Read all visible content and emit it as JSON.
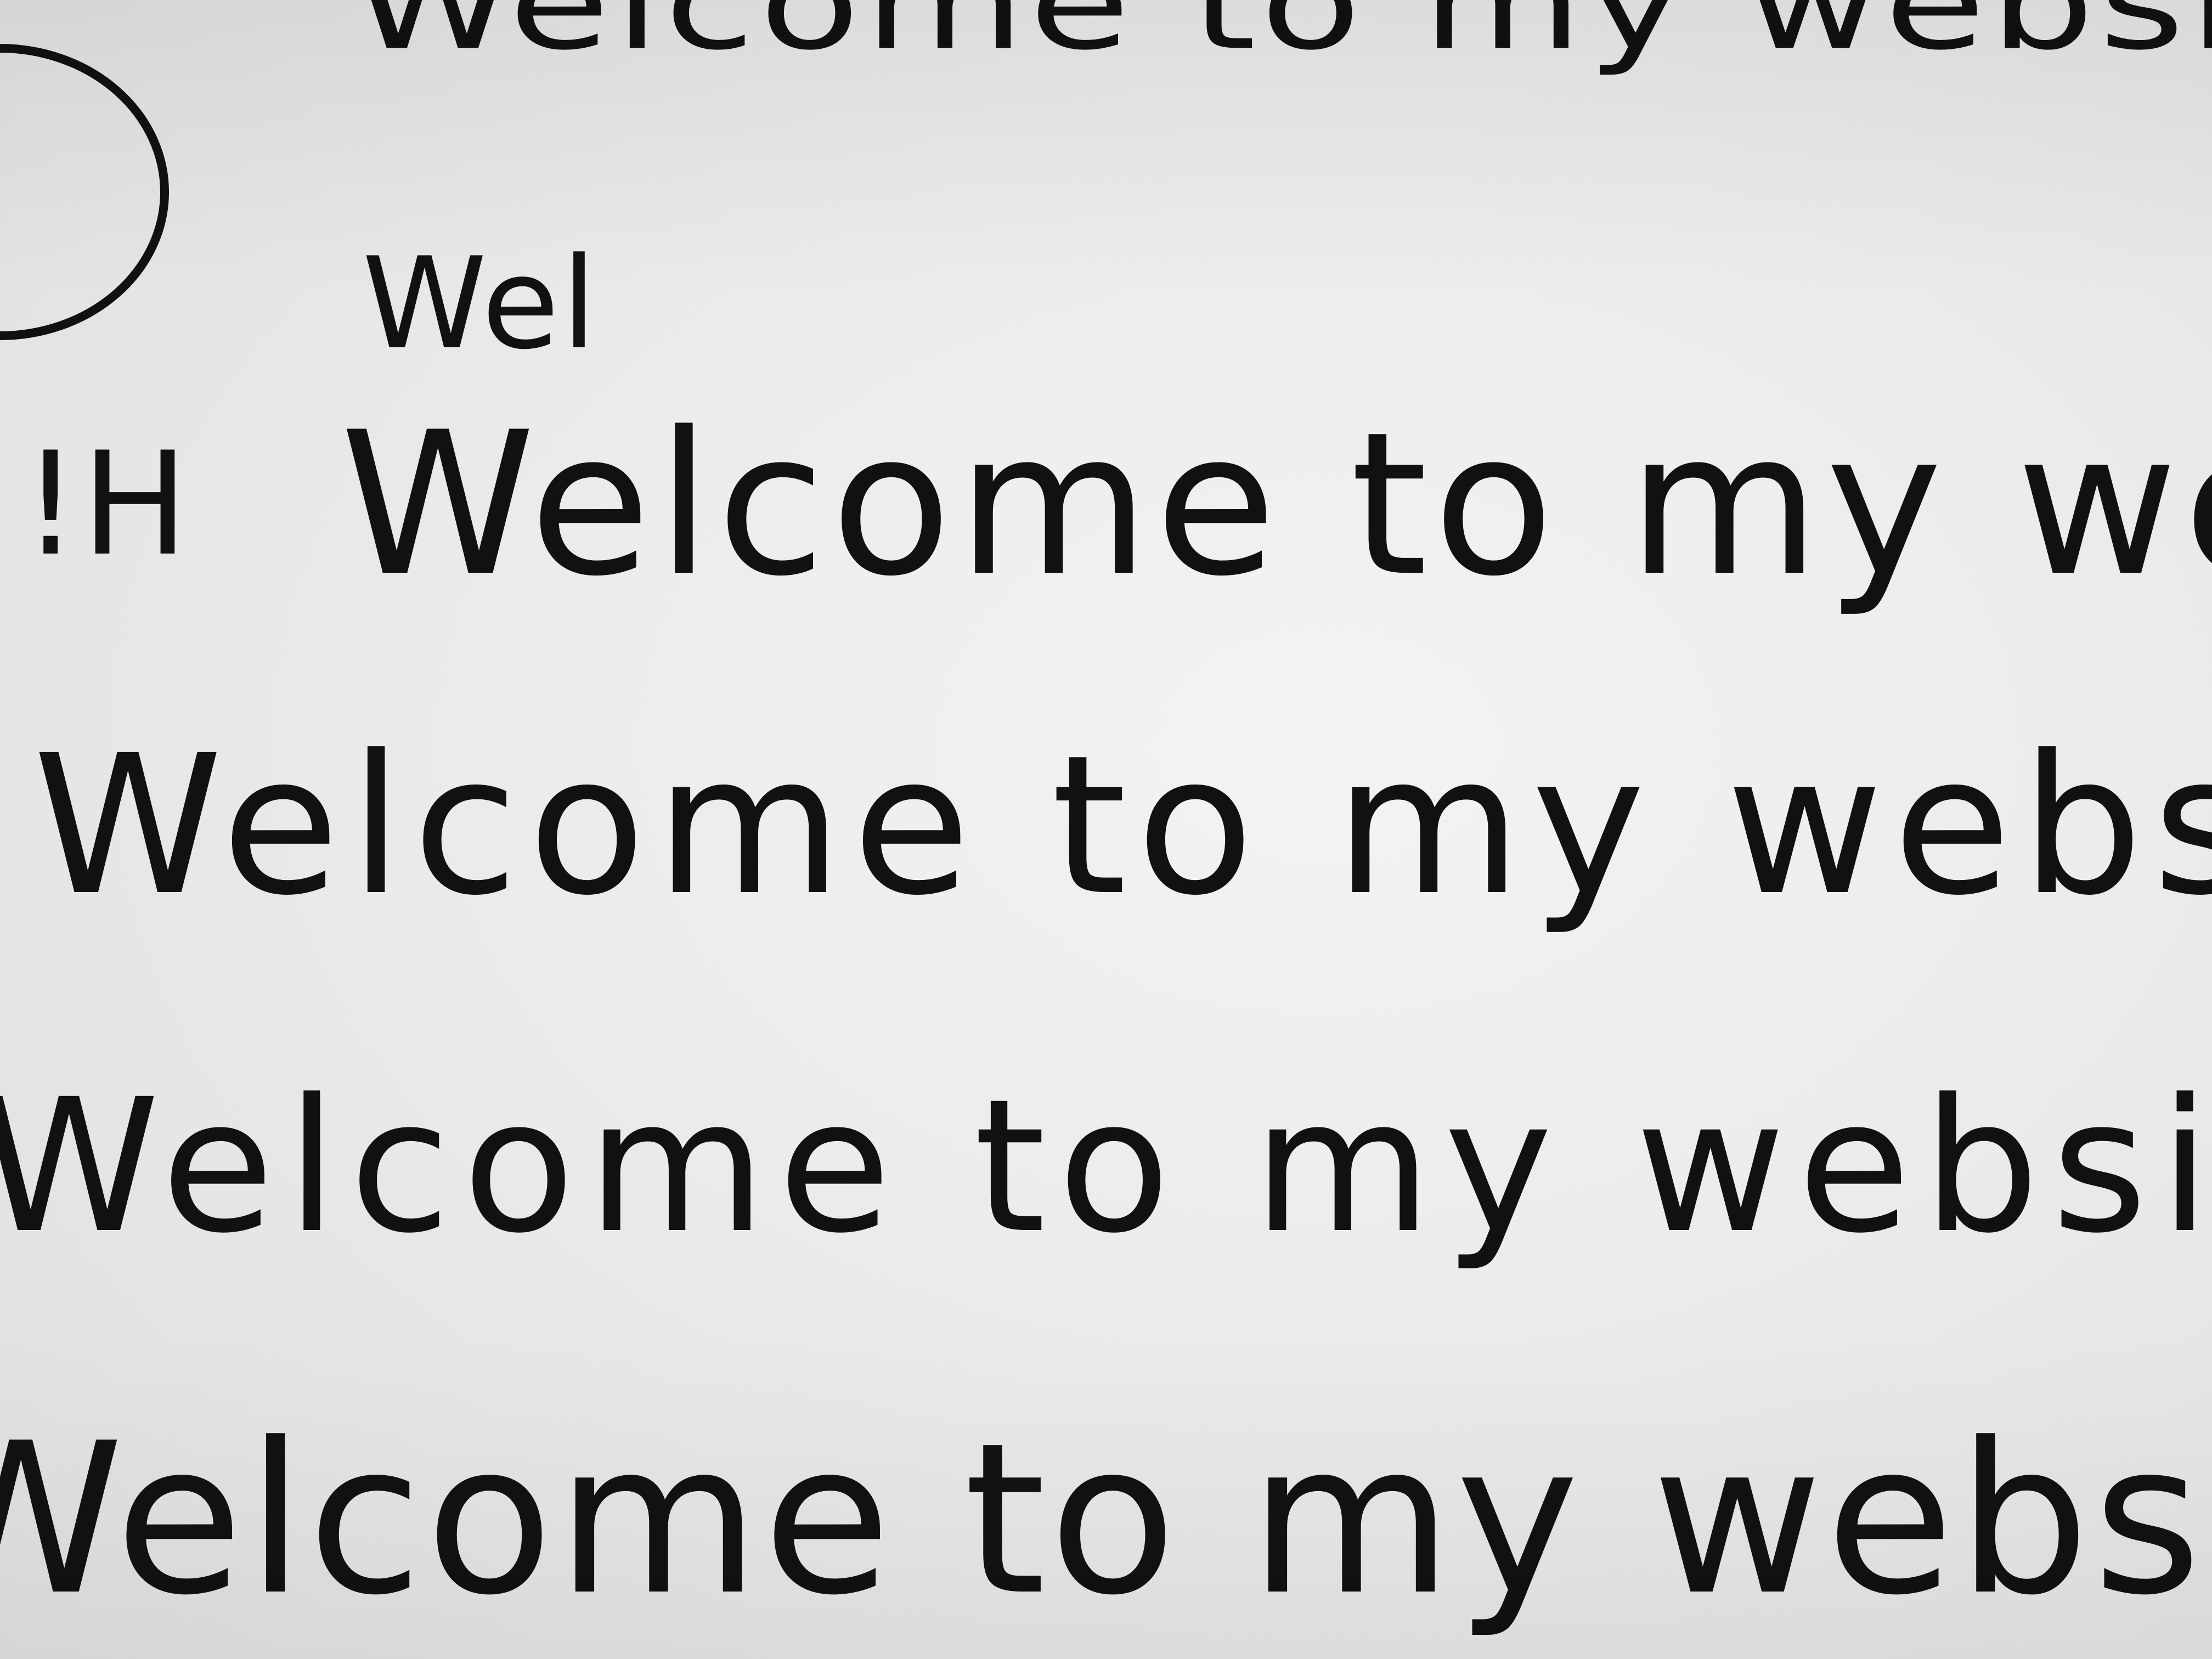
{
  "board": {
    "background_color": "#ecebeb",
    "ink_color": "#111111"
  },
  "handwriting": {
    "line1": "Welcome to my website!",
    "line2": "Wel",
    "line3": "Welcome to my website!",
    "line4": "Welcome to my website!",
    "line5": "Welcome to my website!",
    "line6": "Welcome to my website!",
    "side_mark": "!H"
  },
  "drawing": {
    "shape": "circle"
  }
}
